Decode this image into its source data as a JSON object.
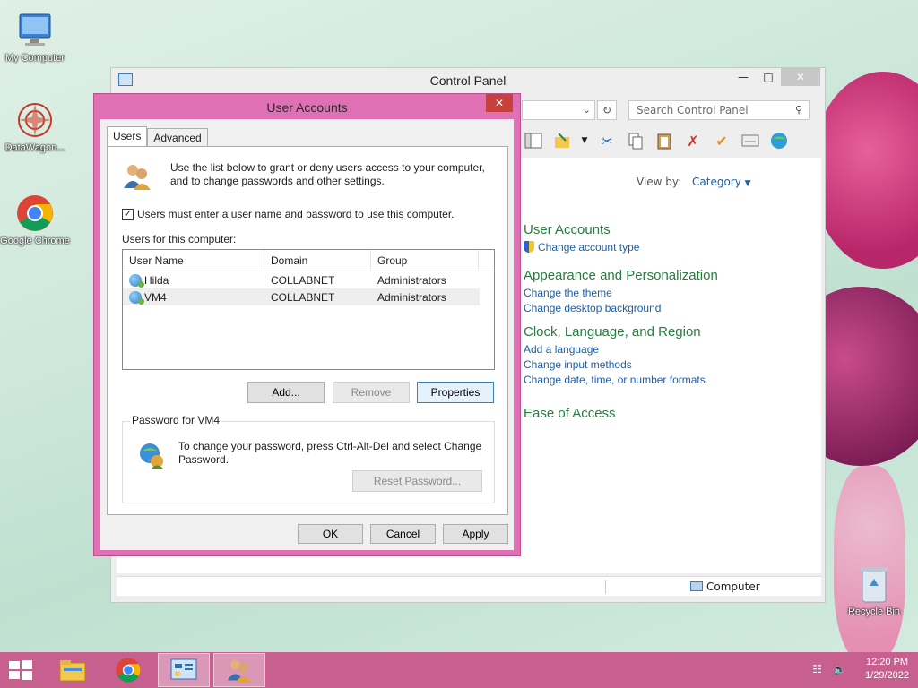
{
  "desktop": {
    "icons": [
      {
        "label": "My Computer"
      },
      {
        "label": "DataWagon..."
      },
      {
        "label": "Google Chrome"
      },
      {
        "label": "Recycle Bin"
      }
    ]
  },
  "control_panel": {
    "title": "Control Panel",
    "search_placeholder": "Search Control Panel",
    "view_by_label": "View by:",
    "view_by_value": "Category",
    "categories": [
      {
        "heading": "User Accounts",
        "links": [
          "Change account type"
        ]
      },
      {
        "heading": "Appearance and Personalization",
        "links": [
          "Change the theme",
          "Change desktop background"
        ]
      },
      {
        "heading": "Clock, Language, and Region",
        "links": [
          "Add a language",
          "Change input methods",
          "Change date, time, or number formats"
        ]
      },
      {
        "heading": "Ease of Access",
        "links": []
      }
    ],
    "status_location": "Computer"
  },
  "user_accounts": {
    "title": "User Accounts",
    "tabs": [
      "Users",
      "Advanced"
    ],
    "intro": "Use the list below to grant or deny users access to your computer, and to change passwords and other settings.",
    "require_login_label": "Users must enter a user name and password to use this computer.",
    "require_login_checked": true,
    "users_for_computer_label": "Users for this computer:",
    "columns": [
      "User Name",
      "Domain",
      "Group"
    ],
    "users": [
      {
        "name": "Hilda",
        "domain": "COLLABNET",
        "group": "Administrators"
      },
      {
        "name": "VM4",
        "domain": "COLLABNET",
        "group": "Administrators"
      }
    ],
    "buttons": {
      "add": "Add...",
      "remove": "Remove",
      "properties": "Properties"
    },
    "password_group_label": "Password for VM4",
    "password_text": "To change your password, press Ctrl-Alt-Del and select Change Password.",
    "reset_password": "Reset Password...",
    "dialog_buttons": {
      "ok": "OK",
      "cancel": "Cancel",
      "apply": "Apply"
    }
  },
  "taskbar": {
    "time": "12:20 PM",
    "date": "1/29/2022"
  },
  "colors": {
    "accent_link": "#1e5ea8",
    "category_heading": "#267d3e",
    "dialog_frame": "#e070b4",
    "taskbar": "#c8608f"
  }
}
